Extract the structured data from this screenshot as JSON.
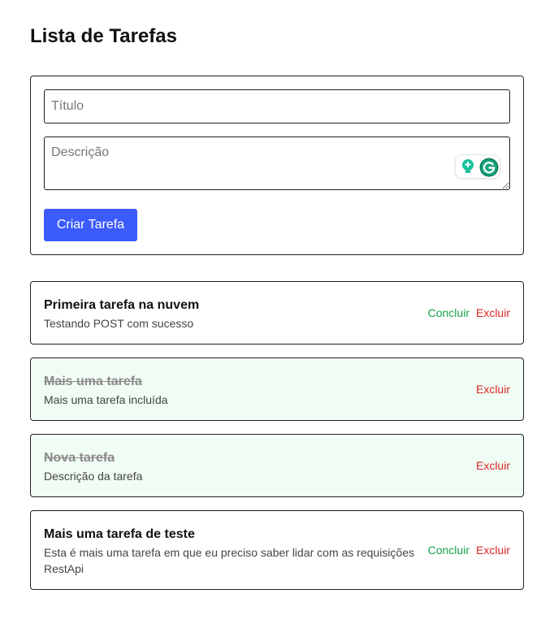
{
  "header": {
    "title": "Lista de Tarefas"
  },
  "form": {
    "title_placeholder": "Título",
    "title_value": "",
    "description_placeholder": "Descrição",
    "description_value": "",
    "submit_label": "Criar Tarefa"
  },
  "tasks": [
    {
      "title": "Primeira tarefa na nuvem",
      "description": "Testando POST com sucesso",
      "completed": false,
      "conclude_label": "Concluir",
      "delete_label": "Excluir"
    },
    {
      "title": "Mais uma tarefa",
      "description": "Mais uma tarefa incluída",
      "completed": true,
      "delete_label": "Excluir"
    },
    {
      "title": "Nova tarefa",
      "description": "Descrição da tarefa",
      "completed": true,
      "delete_label": "Excluir"
    },
    {
      "title": "Mais uma tarefa de teste",
      "description": "Esta é mais uma tarefa em que eu preciso saber lidar com as requisições RestApi",
      "completed": false,
      "conclude_label": "Concluir",
      "delete_label": "Excluir"
    }
  ],
  "icons": {
    "grammarly_suggestion": "lightbulb-icon",
    "grammarly_logo": "grammarly-g-icon"
  },
  "colors": {
    "primary_button": "#3b5bfd",
    "conclude": "#16a34a",
    "delete": "#dc2626",
    "completed_bg": "#f0fdf4",
    "grammarly_green": "#15c39a"
  }
}
